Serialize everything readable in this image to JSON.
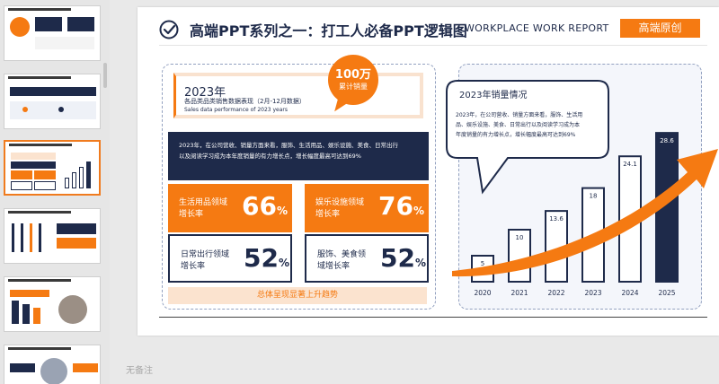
{
  "thumbnails": [
    {
      "id": "slide-1",
      "active": false
    },
    {
      "id": "slide-2",
      "active": false
    },
    {
      "id": "slide-3",
      "active": true
    },
    {
      "id": "slide-4",
      "active": false
    },
    {
      "id": "slide-5",
      "active": false
    },
    {
      "id": "slide-6",
      "active": false
    }
  ],
  "slide": {
    "title": "高端PPT系列之一：打工人必备PPT逻辑图",
    "title_en": "WORKPLACE WORK REPORT",
    "tag": "高端原创",
    "info": {
      "year": "2023年",
      "subtitle": "各品类品类销售数据表现（2月-12月数据）",
      "subtitle_en": "Sales data performance of 2023 years"
    },
    "bubble": {
      "number": "100万",
      "label": "累计销量"
    },
    "description_lines": [
      "2023年，在公司营收、销量方面来看，服饰、生活用品、娱乐设施、美食、日常出行",
      "以及阅读学习成为本年度销量的有力增长点，增长幅度最高可达到69%"
    ],
    "cells": [
      {
        "label": "生活用品领域增长率",
        "value": "66",
        "unit": "%",
        "style": "orange"
      },
      {
        "label": "娱乐设施领域增长率",
        "value": "76",
        "unit": "%",
        "style": "orange"
      },
      {
        "label": "日常出行领域增长率",
        "value": "52",
        "unit": "%",
        "style": "outline"
      },
      {
        "label": "服饰、美食领域增长率",
        "value": "52",
        "unit": "%",
        "style": "outline"
      }
    ],
    "trend": "总体呈现显著上升趋势",
    "chart_callout": {
      "title": "2023年销量情况",
      "lines": [
        "2023年，在公司营收、销量方面来看，服饰、生活用",
        "品、娱乐设施、美食、日常出行以及阅读学习成为本",
        "年度销量的有力增长点，增长幅度最高可达到69%"
      ]
    }
  },
  "chart_data": {
    "type": "bar",
    "categories": [
      "2020",
      "2021",
      "2022",
      "2023",
      "2024",
      "2025"
    ],
    "values": [
      5,
      10,
      13.6,
      18,
      24.1,
      28.6
    ],
    "value_labels": [
      "5",
      "10",
      "13.6",
      "18",
      "24.1",
      "28.6"
    ],
    "ylim": [
      0,
      30
    ],
    "highlight_index": 5,
    "colors": {
      "bar_fill": "#ffffff",
      "bar_stroke": "#1e2a4a",
      "highlight": "#1e2a4a",
      "arrow": "#f57a12"
    }
  },
  "notes_placeholder": "无备注",
  "colors": {
    "accent": "#f57a12",
    "navy": "#1e2a4a",
    "light_orange": "#fbe3cf"
  }
}
